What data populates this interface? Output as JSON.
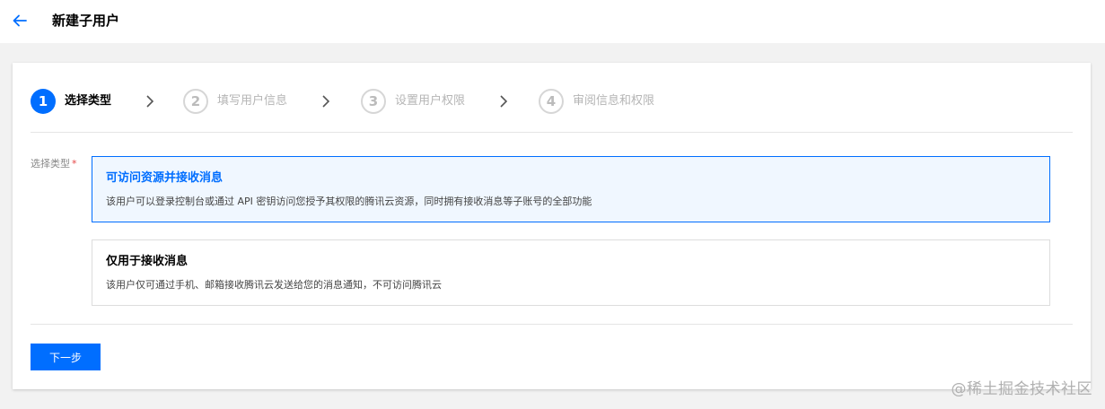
{
  "header": {
    "back_icon": "arrow-left-icon",
    "title": "新建子用户"
  },
  "steps": [
    {
      "number": "1",
      "label": "选择类型",
      "active": true
    },
    {
      "number": "2",
      "label": "填写用户信息",
      "active": false
    },
    {
      "number": "3",
      "label": "设置用户权限",
      "active": false
    },
    {
      "number": "4",
      "label": "审阅信息和权限",
      "active": false
    }
  ],
  "form": {
    "type_label": "选择类型",
    "required_mark": "*",
    "options": [
      {
        "title": "可访问资源并接收消息",
        "description": "该用户可以登录控制台或通过 API 密钥访问您授予其权限的腾讯云资源，同时拥有接收消息等子账号的全部功能",
        "selected": true
      },
      {
        "title": "仅用于接收消息",
        "description": "该用户仅可通过手机、邮箱接收腾讯云发送给您的消息通知，不可访问腾讯云",
        "selected": false
      }
    ],
    "next_button": "下一步"
  },
  "watermark": "@稀土掘金技术社区",
  "colors": {
    "accent": "#006eff",
    "selected_bg": "#f0f7ff",
    "required": "#e54545"
  }
}
